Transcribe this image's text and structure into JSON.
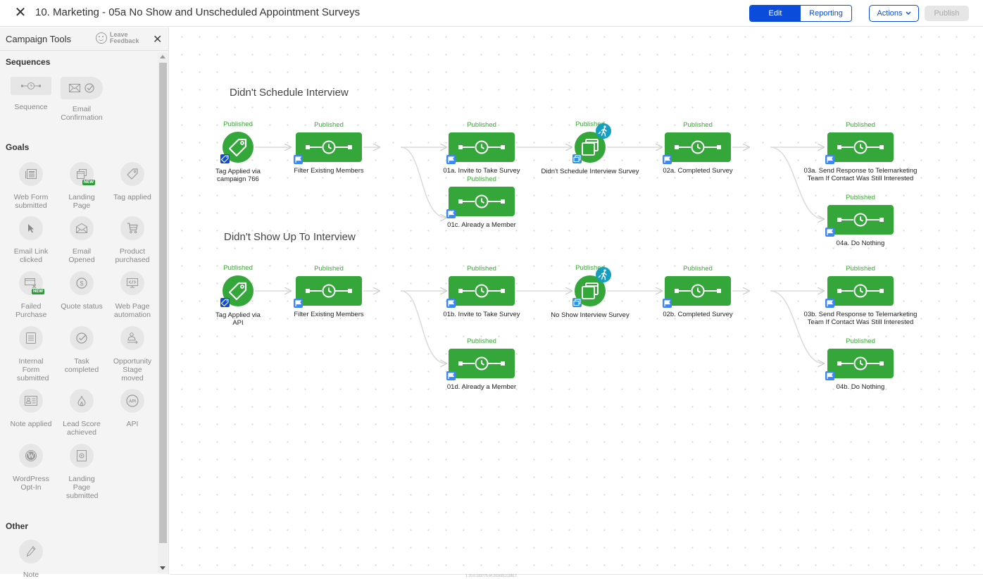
{
  "header": {
    "title": "10. Marketing - 05a No Show and Unscheduled Appointment Surveys",
    "close_icon": "close-icon",
    "tabs": [
      {
        "label": "Edit",
        "active": true
      },
      {
        "label": "Reporting",
        "active": false
      }
    ],
    "actions_label": "Actions",
    "publish_label": "Publish"
  },
  "sidebar": {
    "title": "Campaign Tools",
    "feedback_line1": "Leave",
    "feedback_line2": "Feedback",
    "sections": {
      "sequences": {
        "title": "Sequences",
        "items": [
          {
            "label": "Sequence",
            "icon": "sequence-icon"
          },
          {
            "label_line1": "Email",
            "label_line2": "Confirmation",
            "icon": "email-confirmation-icon"
          }
        ]
      },
      "goals": {
        "title": "Goals",
        "items": [
          {
            "label": "Web Form submitted",
            "icon": "web-form-icon"
          },
          {
            "label": "Landing Page",
            "icon": "landing-page-icon",
            "badge": "NEW"
          },
          {
            "label": "Tag applied",
            "icon": "tag-icon"
          },
          {
            "label": "Email Link clicked",
            "icon": "cursor-icon"
          },
          {
            "label": "Email Opened",
            "icon": "envelope-open-icon"
          },
          {
            "label": "Product purchased",
            "icon": "cart-icon"
          },
          {
            "label": "Failed Purchase",
            "icon": "failed-purchase-icon",
            "badge": "NEW"
          },
          {
            "label": "Quote status",
            "icon": "dollar-icon"
          },
          {
            "label": "Web Page automation",
            "icon": "code-monitor-icon"
          },
          {
            "label": "Internal Form submitted",
            "icon": "internal-form-icon"
          },
          {
            "label": "Task completed",
            "icon": "check-circle-icon"
          },
          {
            "label": "Opportunity Stage moved",
            "icon": "opportunity-icon"
          },
          {
            "label": "Note applied",
            "icon": "id-card-icon"
          },
          {
            "label": "Lead Score achieved",
            "icon": "flame-icon"
          },
          {
            "label": "API",
            "icon": "api-icon"
          },
          {
            "label": "WordPress Opt-In",
            "icon": "wordpress-icon"
          },
          {
            "label": "Landing Page submitted",
            "icon": "landing-page-submitted-icon"
          }
        ]
      },
      "other": {
        "title": "Other",
        "items": [
          {
            "label": "Note",
            "icon": "pencil-icon"
          }
        ]
      }
    }
  },
  "canvas": {
    "groups": [
      {
        "title": "Didn't Schedule Interview"
      },
      {
        "title": "Didn't Show Up To Interview"
      }
    ],
    "status_text": "Published",
    "nodes": {
      "g1_tag": {
        "status": "Published",
        "label_line1": "Tag Applied via",
        "label_line2": "campaign 766",
        "type": "tag-goal"
      },
      "g1_filter": {
        "status": "Published",
        "label": "Filter Existing Members",
        "type": "sequence"
      },
      "g1_01a": {
        "status": "Published",
        "label": "01a. Invite to Take Survey",
        "type": "sequence"
      },
      "g1_01c": {
        "status": "Published",
        "label": "01c. Already a Member",
        "type": "sequence"
      },
      "g1_lp": {
        "status": "Published",
        "label": "Didn't Schedule Interview Survey",
        "type": "landing-page-goal"
      },
      "g1_02a": {
        "status": "Published",
        "label": "02a. Completed Survey",
        "type": "sequence"
      },
      "g1_03a": {
        "status": "Published",
        "label_line1": "03a. Send Response to Telemarketing",
        "label_line2": "Team If Contact Was Still Interested",
        "type": "sequence"
      },
      "g1_04a": {
        "status": "Published",
        "label": "04a. Do Nothing",
        "type": "sequence"
      },
      "g2_tag": {
        "status": "Published",
        "label_line1": "Tag Applied via",
        "label_line2": "API",
        "type": "tag-goal"
      },
      "g2_filter": {
        "status": "Published",
        "label": "Filter Existing Members",
        "type": "sequence"
      },
      "g2_01b": {
        "status": "Published",
        "label": "01b. Invite to Take Survey",
        "type": "sequence"
      },
      "g2_01d": {
        "status": "Published",
        "label": "01d. Already a Member",
        "type": "sequence"
      },
      "g2_lp": {
        "status": "Published",
        "label": "No Show Interview Survey",
        "type": "landing-page-goal"
      },
      "g2_02b": {
        "status": "Published",
        "label": "02b. Completed Survey",
        "type": "sequence"
      },
      "g2_03b": {
        "status": "Published",
        "label_line1": "03b. Send Response to Telemarketing",
        "label_line2": "Team If Contact Was Still Interested",
        "type": "sequence"
      },
      "g2_04b": {
        "status": "Published",
        "label": "04b. Do Nothing",
        "type": "sequence"
      }
    }
  },
  "footer": {
    "version": "1.70.0.183775-hf-202001210817"
  },
  "colors": {
    "brand_blue": "#0b4dda",
    "node_green": "#34a63a",
    "status_green": "#3aaa35",
    "flag_blue": "#3d86f5",
    "walk_teal": "#139fc2"
  }
}
